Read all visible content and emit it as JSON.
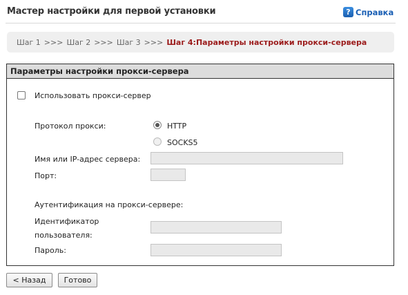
{
  "header": {
    "title": "Мастер настройки для первой установки",
    "help_label": "Справка",
    "help_icon": "help-question-icon"
  },
  "breadcrumb": {
    "steps": [
      "Шаг 1",
      "Шаг 2",
      "Шаг 3"
    ],
    "separator": ">>>",
    "current": "Шаг 4:Параметры настройки прокси-сервера"
  },
  "panel": {
    "title": "Параметры настройки прокси-сервера",
    "use_proxy_label": "Использовать прокси-сервер",
    "use_proxy_checked": false,
    "protocol_label": "Протокол прокси:",
    "protocol_options": [
      {
        "label": "HTTP",
        "selected": true
      },
      {
        "label": "SOCKS5",
        "selected": false
      }
    ],
    "server_label": "Имя или IP-адрес сервера:",
    "server_value": "",
    "port_label": "Порт:",
    "port_value": "",
    "auth_label": "Аутентификация на прокси-сервере:",
    "user_id_label_line1": "Идентификатор",
    "user_id_label_line2": "пользователя:",
    "user_id_value": "",
    "password_label": "Пароль:",
    "password_value": ""
  },
  "buttons": {
    "back": "< Назад",
    "finish": "Готово"
  },
  "colors": {
    "accent_link": "#1a5fb4",
    "current_step": "#9b1b1b",
    "panel_header_bg": "#dcdcdc"
  }
}
